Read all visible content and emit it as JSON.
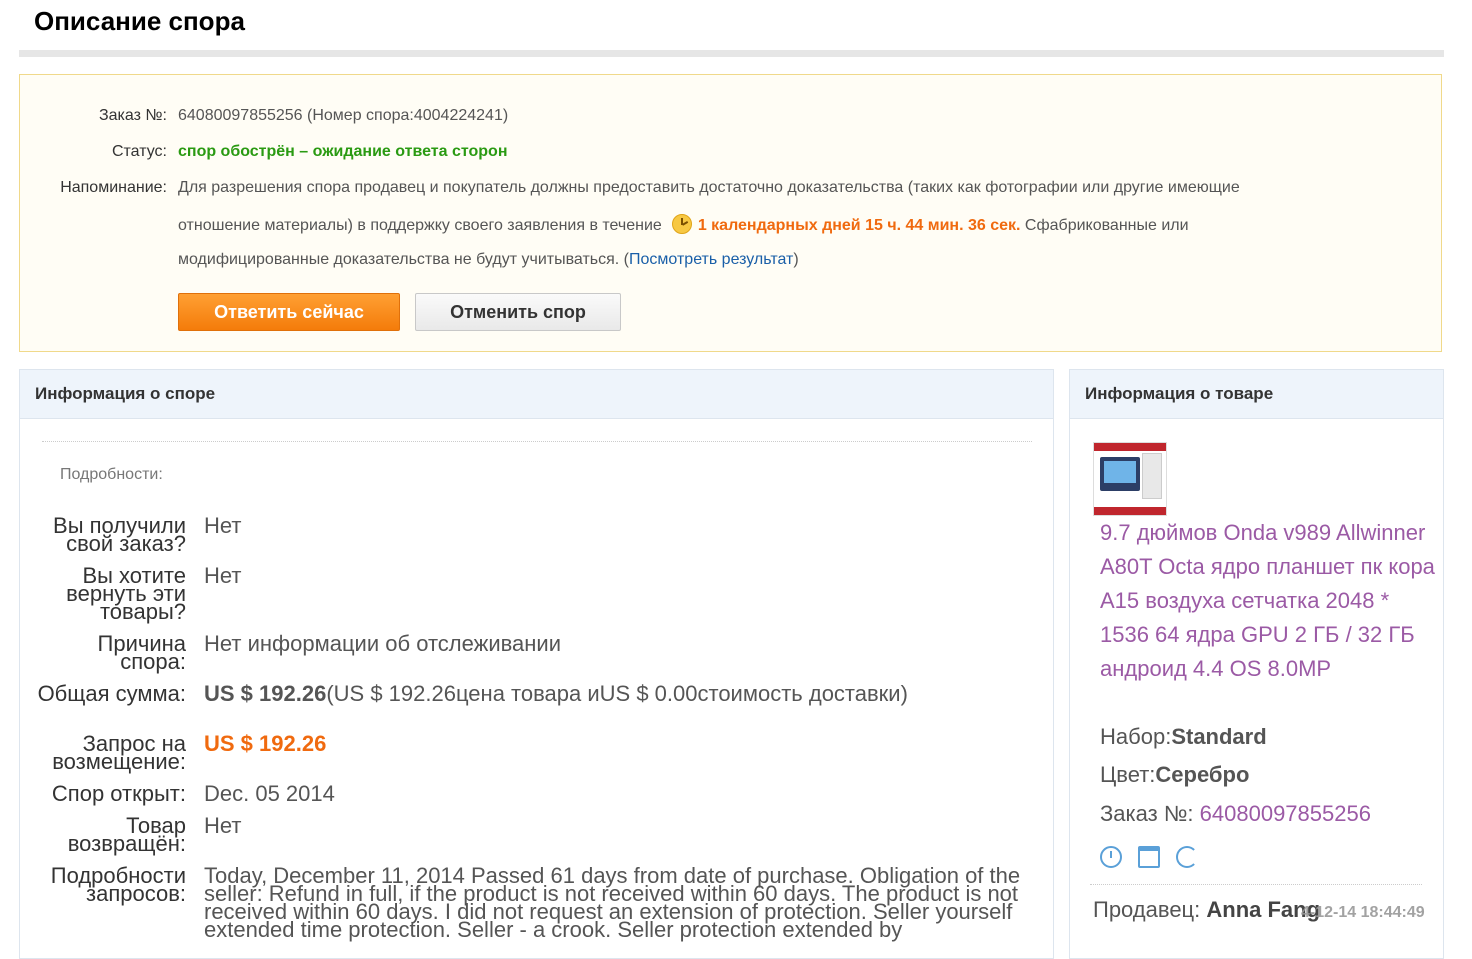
{
  "page": {
    "title": "Описание спора"
  },
  "notice": {
    "order_label": "Заказ №:",
    "order_value": "64080097855256 (Номер спора:4004224241)",
    "status_label": "Статус:",
    "status_value": "спор обострён – ожидание ответа сторон",
    "reminder_label": "Напоминание:",
    "reminder_line1": "Для разрешения спора продавец и покупатель должны предоставить достаточно доказательства (таких как фотографии или другие имеющие",
    "reminder_line2_pre": "отношение материалы) в поддержку своего заявления в течение",
    "timer": "1 календарных дней 15 ч. 44 мин. 36 сек.",
    "reminder_line2_post": " Сфабрикованные или",
    "reminder_line3": "модифицированные доказательства не будут учитываться. (",
    "link_text": "Посмотреть результат",
    "reminder_line3_end": ")",
    "respond_button": "Ответить сейчас",
    "cancel_button": "Отменить спор"
  },
  "dispute": {
    "header": "Информация о споре",
    "details_heading": "Подробности:",
    "rows": [
      {
        "label": "Вы получили свой заказ?",
        "value": "Нет"
      },
      {
        "label": "Вы хотите вернуть эти товары?",
        "value": "Нет"
      },
      {
        "label": "Причина спора:",
        "value": "Нет информации об отслеживании"
      },
      {
        "label": "Общая сумма:",
        "amount": "US $ 192.26",
        "value_suffix": "(US $ 192.26цена товара иUS $ 0.00стоимость доставки)"
      },
      {
        "label": "Запрос на возмещение:",
        "value": "US $ 192.26"
      },
      {
        "label": "Спор открыт:",
        "value": "Dec. 05 2014"
      },
      {
        "label": "Товар возвращён:",
        "value": "Нет"
      },
      {
        "label": "Подробности запросов:",
        "value": "Today, December 11, 2014 Passed 61 days from date of purchase. Obligation of the seller: Refund in full, if the product is not received within 60 days. The product is not received within 60 days. I did not request an extension of protection. Seller yourself extended time protection. Seller - a crook. Seller protection extended by"
      }
    ]
  },
  "product": {
    "header": "Информация о товаре",
    "title": "9.7 дюймов Onda v989 Allwinner A80T Octa ядро планшет пк кора A15 воздуха сетчатка 2048 * 1536 64 ядра GPU 2 ГБ / 32 ГБ андроид 4.4 OS 8.0MP",
    "set_label": "Набор:",
    "set_value": "Standard",
    "color_label": "Цвет:",
    "color_value": "Серебро",
    "order_label": "Заказ №: ",
    "order_value": "64080097855256",
    "icons": [
      "alarm-icon",
      "calendar-icon",
      "refresh-icon"
    ],
    "seller_label": "Продавец: ",
    "seller_name": "Anna Fang"
  },
  "timestamp": "4-12-14 18:44:49",
  "colors": {
    "accent": "#f47c0a",
    "status": "#2a9a12",
    "link": "#1a5fa8",
    "product_link": "#9b5aa5"
  }
}
